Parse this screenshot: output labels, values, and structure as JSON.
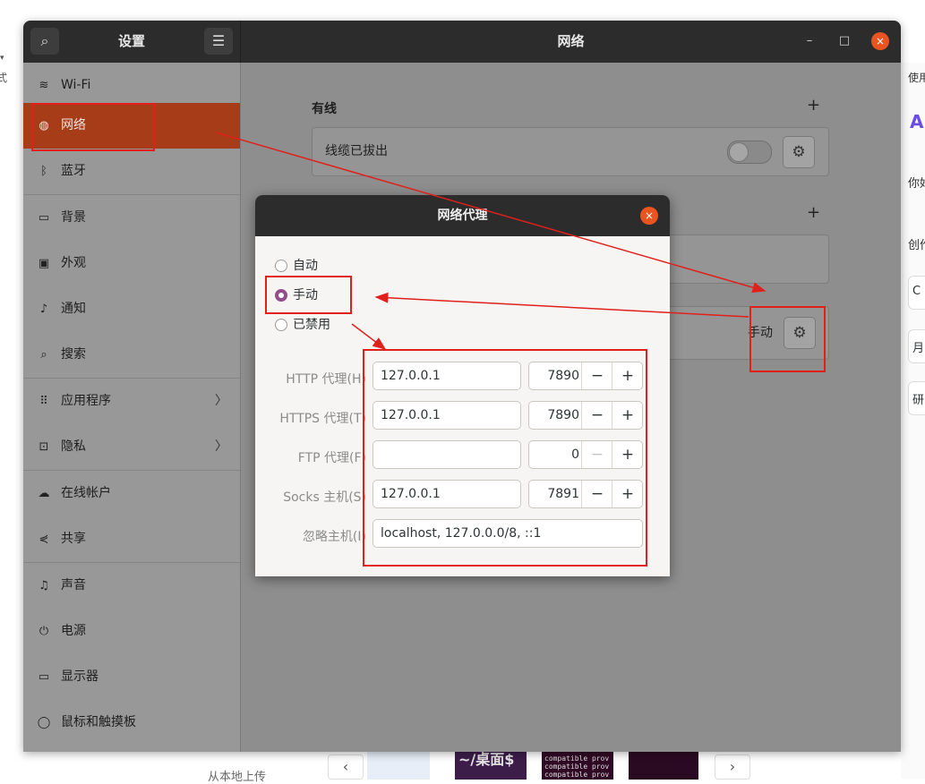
{
  "background": {
    "left_fragment": "式",
    "right_fragments": [
      "使用",
      "你好",
      "创作",
      "C",
      "月",
      "研"
    ],
    "upload_label": "从本地上传",
    "thumb_text": "~/桌面$",
    "thumb_lines": [
      "compatible prov",
      "compatible prov",
      "compatible prov"
    ],
    "prev_icon": "‹",
    "next_icon": "›"
  },
  "window": {
    "sidebar_title": "设置",
    "main_title": "网络",
    "search_icon": "⌕",
    "menu_icon": "☰",
    "minimize": "–",
    "maximize": "□",
    "close": "×"
  },
  "sidebar": {
    "items": [
      {
        "label": "Wi-Fi",
        "icon": "wifi-icon",
        "glyph": "≋"
      },
      {
        "label": "网络",
        "icon": "network-icon",
        "glyph": "◍",
        "active": true
      },
      {
        "label": "蓝牙",
        "icon": "bluetooth-icon",
        "glyph": "ᛒ"
      },
      {
        "label": "背景",
        "icon": "background-icon",
        "glyph": "▭"
      },
      {
        "label": "外观",
        "icon": "appearance-icon",
        "glyph": "▣"
      },
      {
        "label": "通知",
        "icon": "bell-icon",
        "glyph": "♫"
      },
      {
        "label": "搜索",
        "icon": "search-icon",
        "glyph": "⌕"
      },
      {
        "label": "应用程序",
        "icon": "apps-icon",
        "glyph": "⠿",
        "chevron": "〉"
      },
      {
        "label": "隐私",
        "icon": "lock-icon",
        "glyph": "🔒",
        "chevron": "〉"
      },
      {
        "label": "在线帐户",
        "icon": "cloud-icon",
        "glyph": "☁"
      },
      {
        "label": "共享",
        "icon": "share-icon",
        "glyph": "⋞"
      },
      {
        "label": "声音",
        "icon": "music-icon",
        "glyph": "♫"
      },
      {
        "label": "电源",
        "icon": "power-icon",
        "glyph": "⏻"
      },
      {
        "label": "显示器",
        "icon": "display-icon",
        "glyph": "▭"
      },
      {
        "label": "鼠标和触摸板",
        "icon": "mouse-icon",
        "glyph": "◯"
      }
    ]
  },
  "network": {
    "wired_title": "有线",
    "wired_add": "+",
    "wired_status": "线缆已拔出",
    "vpn_add": "+",
    "proxy_status": "手动",
    "gear": "⚙"
  },
  "proxy_dialog": {
    "title": "网络代理",
    "close": "×",
    "modes": [
      {
        "label": "自动",
        "selected": false
      },
      {
        "label": "手动",
        "selected": true
      },
      {
        "label": "已禁用",
        "selected": false
      }
    ],
    "rows": [
      {
        "label": "HTTP 代理(H)",
        "host": "127.0.0.1",
        "port": "7890"
      },
      {
        "label": "HTTPS 代理(T)",
        "host": "127.0.0.1",
        "port": "7890"
      },
      {
        "label": "FTP 代理(F)",
        "host": "",
        "port": "0"
      },
      {
        "label": "Socks 主机(S)",
        "host": "127.0.0.1",
        "port": "7891"
      }
    ],
    "ignore_label": "忽略主机(I)",
    "ignore_value": "localhost, 127.0.0.0/8, ::1",
    "minus": "−",
    "plus": "+"
  },
  "annotation_color": "#e0201a",
  "accent": "#e95420",
  "radio_color": "#924d8b"
}
